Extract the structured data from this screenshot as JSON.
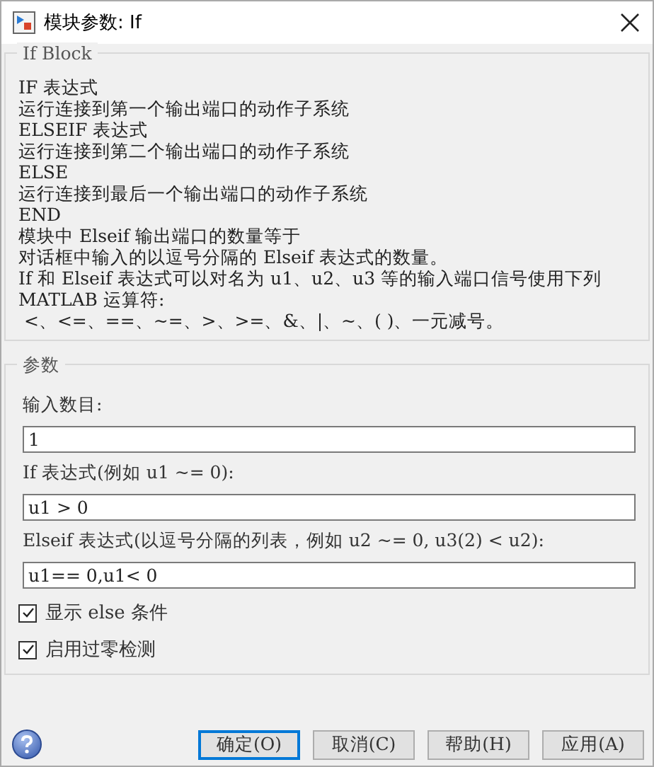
{
  "window": {
    "title": "模块参数: If"
  },
  "description": {
    "title": "If Block",
    "lines": [
      "IF 表达式",
      "运行连接到第一个输出端口的动作子系统",
      "ELSEIF 表达式",
      "运行连接到第二个输出端口的动作子系统",
      "ELSE",
      "运行连接到最后一个输出端口的动作子系统",
      "END",
      "模块中 Elseif 输出端口的数量等于",
      "对话框中输入的以逗号分隔的 Elseif 表达式的数量。",
      "If 和 Elseif 表达式可以对名为 u1、u2、u3 等的输入端口信号使用下列",
      "MATLAB 运算符:",
      " <、<=、==、~=、>、>=、&、|、~、( )、一元减号。"
    ]
  },
  "parameters": {
    "title": "参数",
    "fields": [
      {
        "label": "输入数目:",
        "value": "1"
      },
      {
        "label": "If 表达式(例如 u1 ~= 0):",
        "value": "u1 > 0"
      },
      {
        "label": "Elseif 表达式(以逗号分隔的列表，例如 u2 ~= 0, u3(2) < u2):",
        "value": "u1== 0,u1< 0"
      }
    ],
    "checkboxes": [
      {
        "label": "显示 else 条件",
        "checked": true
      },
      {
        "label": "启用过零检测",
        "checked": true
      }
    ]
  },
  "buttons": [
    {
      "label": "确定(O)",
      "selected": true
    },
    {
      "label": "取消(C)",
      "selected": false
    },
    {
      "label": "帮助(H)",
      "selected": false
    },
    {
      "label": "应用(A)",
      "selected": false
    }
  ]
}
